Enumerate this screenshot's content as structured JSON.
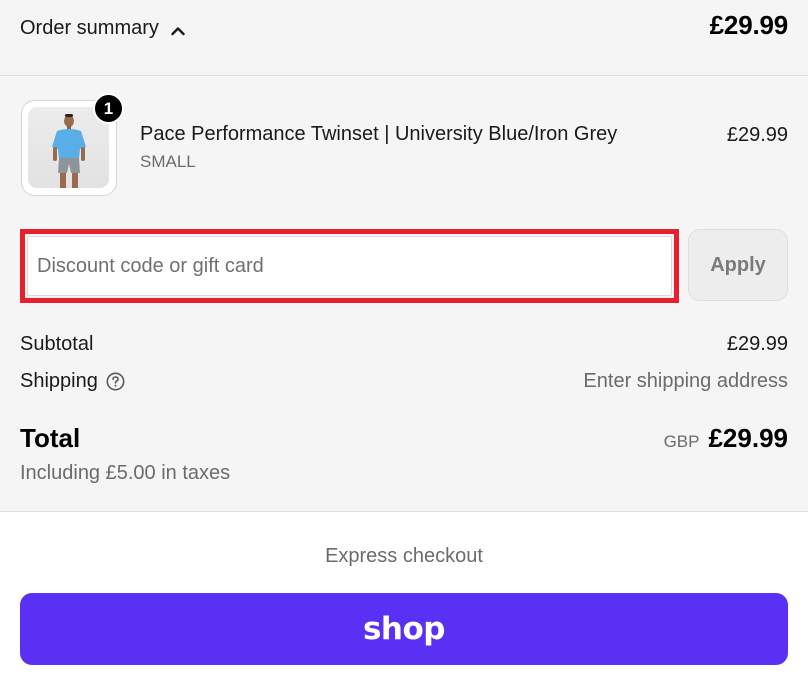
{
  "order_summary": {
    "toggle_label": "Order summary",
    "toggle_icon": "chevron-up-icon",
    "header_total": "£29.99"
  },
  "line_item": {
    "quantity": "1",
    "name": "Pace Performance Twinset | University Blue/Iron Grey",
    "variant": "SMALL",
    "price": "£29.99",
    "shirt_color": "#5aaee8",
    "shorts_color": "#8f949a"
  },
  "discount": {
    "placeholder": "Discount code or gift card",
    "value": "",
    "apply_label": "Apply",
    "highlight_color": "#e8202e"
  },
  "costs": {
    "subtotal_label": "Subtotal",
    "subtotal_value": "£29.99",
    "shipping_label": "Shipping",
    "shipping_help_icon": "question-circle-icon",
    "shipping_value": "Enter shipping address",
    "total_label": "Total",
    "currency_code": "GBP",
    "total_value": "£29.99",
    "taxes_note": "Including £5.00 in taxes"
  },
  "express_checkout": {
    "label": "Express checkout",
    "shop_pay_label": "shop",
    "shop_pay_color": "#5a31f4"
  }
}
